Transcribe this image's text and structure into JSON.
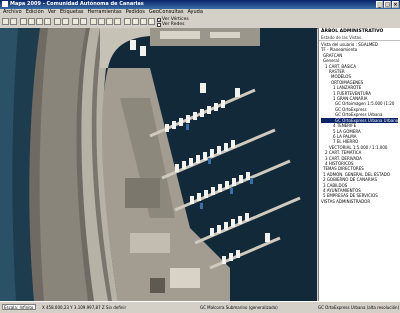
{
  "window": {
    "title": "Mapa 2009 - Comunidad Autónoma de Canarias"
  },
  "menu": [
    "Archivo",
    "Edición",
    "Ver",
    "Etiquetas",
    "Herramientas",
    "Pedidos",
    "GeoConsultas",
    "Ayuda"
  ],
  "toolbar": {
    "check1": "Ver Vértices",
    "check2": "Ver Redes"
  },
  "panel": {
    "title": "ÁRBOL ADMINISTRATIVO",
    "subtitle": "Estado de las Vistas",
    "items": [
      "Vista del usuario : SGALMED",
      "TF - Planeamiento",
      "GRAFCAN",
      "General",
      "1 CART. BÁSICA",
      "RASTER",
      "MODELOS",
      "ORTOIMÁGENES",
      "1 LANZAROTE",
      "1 FUERTEVENTURA",
      "1 GRAN CANARIA",
      "GC Ortoimagen 1:5.000 (1:20",
      "GC OrtoExpress",
      "GC OrtoExpress Urbana",
      "GC OrtoExpress Urbana Urbano",
      "4 TENERIFE",
      "5 LA GOMERA",
      "6 LA PALMA",
      "7 EL HIERRO",
      "VECTORIAL 1:5.000 / 1:1.000",
      "2 CART. TEMÁTICA",
      "3 CART. DERIVADA",
      "4 HISTÓRICOS",
      "TEMAS DIRECTORES",
      "1 ADMÓN. GENERAL DEL ESTADO",
      "2 GOBIERNO DE CANARIAS",
      "3 CABILDOS",
      "4 AYUNTAMIENTOS",
      "5 EMPRESAS DE SERVICIOS",
      "VISTAS ADMINISTRADOR"
    ]
  },
  "status": {
    "selection": "Escala: Infinito",
    "coords": "X 458.000,23  Y 3.109.997,87  Z Sin definir",
    "layer1": "GC Malcorra Submarino (generalizado)",
    "layer2": "GC OrtoExpress Urbana (alta resolución)"
  }
}
